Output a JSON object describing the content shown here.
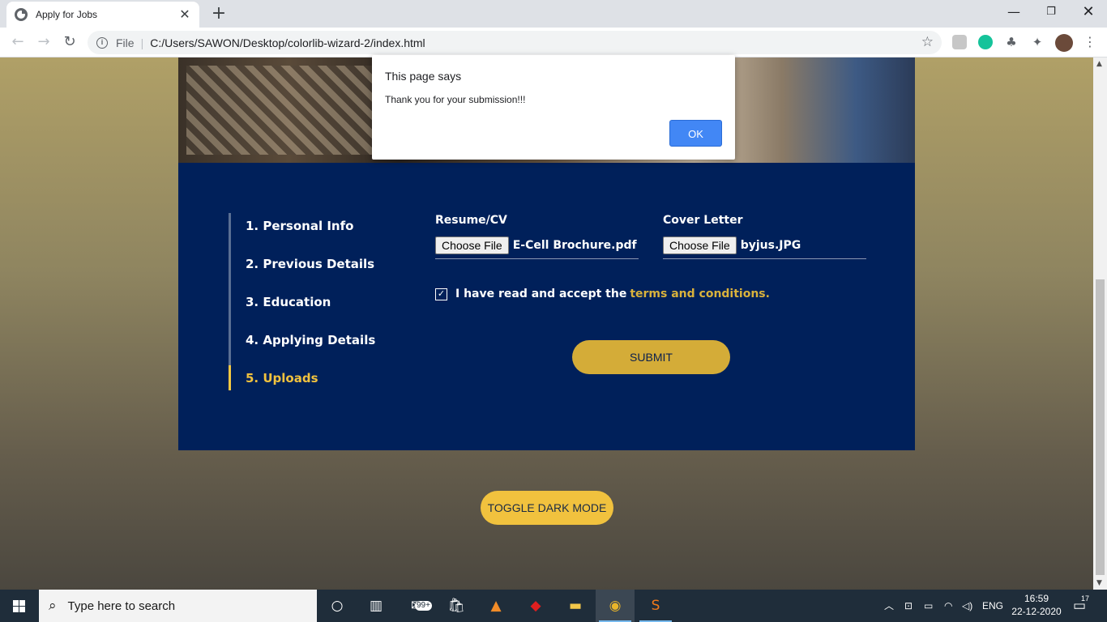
{
  "browser": {
    "tab_title": "Apply for Jobs",
    "new_tab_label": "+",
    "url_scheme_label": "File",
    "url": "C:/Users/SAWON/Desktop/colorlib-wizard-2/index.html"
  },
  "wizard": {
    "steps": [
      {
        "label": "1. Personal Info",
        "active": false
      },
      {
        "label": "2. Previous Details",
        "active": false
      },
      {
        "label": "3. Education",
        "active": false
      },
      {
        "label": "4. Applying Details",
        "active": false
      },
      {
        "label": "5. Uploads",
        "active": true
      }
    ],
    "resume": {
      "label": "Resume/CV",
      "button": "Choose File",
      "file": "E-Cell Brochure.pdf"
    },
    "cover": {
      "label": "Cover Letter",
      "button": "Choose File",
      "file": "byjus.JPG"
    },
    "accept_text": "I have read and accept the",
    "terms_link": "terms and conditions.",
    "accepted": true,
    "submit_label": "SUBMIT"
  },
  "toggle_label": "TOGGLE DARK MODE",
  "dialog": {
    "title": "This page says",
    "message": "Thank you for your submission!!!",
    "ok_label": "OK"
  },
  "taskbar": {
    "search_placeholder": "Type here to search",
    "mail_badge": "99+",
    "language": "ENG",
    "time": "16:59",
    "date": "22-12-2020",
    "notification_count": "17"
  },
  "colors": {
    "card": "#00205a",
    "accent": "#f1c23e",
    "dialog_ok": "#4287f5"
  }
}
